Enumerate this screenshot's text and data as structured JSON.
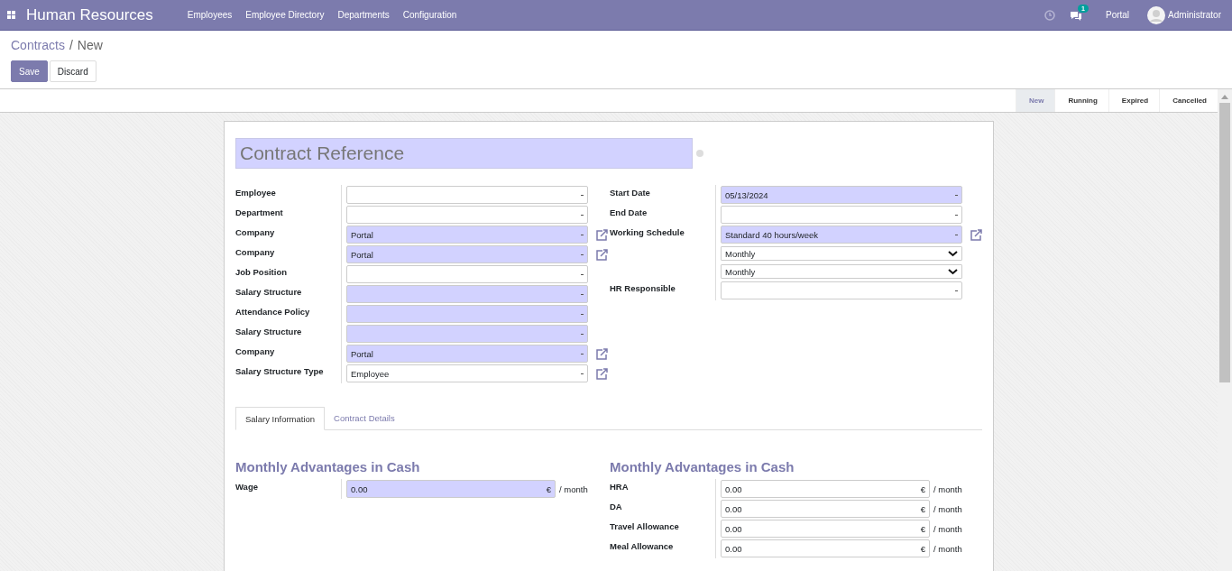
{
  "navbar": {
    "app_title": "Human Resources",
    "menu": [
      "Employees",
      "Employee Directory",
      "Departments",
      "Configuration"
    ],
    "messages_badge": "1",
    "company": "Portal",
    "user": "Administrator"
  },
  "breadcrumbs": [
    {
      "label": "Contracts",
      "link": true
    },
    {
      "separator": "/",
      "label": "New",
      "link": false
    }
  ],
  "buttons": [
    {
      "label": "Save",
      "kind": "primary"
    },
    {
      "label": "Discard",
      "kind": "secondary"
    }
  ],
  "statusbar": [
    {
      "label": "New",
      "selected": true
    },
    {
      "label": "Running",
      "selected": false
    },
    {
      "label": "Expired",
      "selected": false
    },
    {
      "label": "Cancelled",
      "selected": false
    }
  ],
  "form": {
    "title_placeholder": "Contract Reference",
    "left_fields": [
      {
        "label": "Employee",
        "kind": "many2one",
        "required": false,
        "link": false
      },
      {
        "label": "Department",
        "kind": "many2one",
        "required": false,
        "link": false
      },
      {
        "label": "Company",
        "kind": "many2one",
        "value": "Portal",
        "required": true,
        "link": true
      },
      {
        "label": "Company",
        "kind": "many2one",
        "value": "Portal",
        "required": true,
        "link": true
      },
      {
        "label": "Job Position",
        "kind": "many2one",
        "required": false,
        "link": false
      },
      {
        "label": "Salary Structure",
        "kind": "many2one",
        "required": true,
        "link": false
      },
      {
        "label": "Attendance Policy",
        "kind": "many2one",
        "required": true,
        "link": false
      },
      {
        "label": "Salary Structure",
        "kind": "many2one",
        "required": true,
        "link": false
      },
      {
        "label": "Company",
        "kind": "many2one",
        "value": "Portal",
        "required": true,
        "link": true
      },
      {
        "label": "Salary Structure Type",
        "kind": "many2one",
        "value": "Employee",
        "required": false,
        "link": true
      }
    ],
    "right_fields": [
      {
        "label": "Start Date",
        "kind": "date",
        "value": "05/13/2024",
        "required": true,
        "link": false
      },
      {
        "label": "End Date",
        "kind": "date",
        "required": false,
        "link": false
      },
      {
        "label": "Working Schedule",
        "kind": "many2one",
        "value": "Standard 40 hours/week",
        "required": true,
        "link": true
      },
      {
        "kind": "select",
        "value": "Monthly",
        "required": false,
        "link": false
      },
      {
        "kind": "select",
        "value": "Monthly",
        "required": false,
        "link": false
      },
      {
        "label": "HR Responsible",
        "kind": "many2one",
        "required": false,
        "link": false
      }
    ],
    "tabs": [
      {
        "label": "Salary Information",
        "selected": true
      },
      {
        "label": "Contract Details",
        "selected": false
      }
    ],
    "sections": [
      {
        "heading": "Monthly Advantages in Cash",
        "rows": [
          {
            "label": "Wage",
            "value": "0.00",
            "currency": "€",
            "unit": "/ month",
            "required": true
          }
        ]
      },
      {
        "heading": "Monthly Advantages in Cash",
        "rows": [
          {
            "label": "HRA",
            "value": "0.00",
            "currency": "€",
            "unit": "/ month",
            "required": false
          },
          {
            "label": "DA",
            "value": "0.00",
            "currency": "€",
            "unit": "/ month",
            "required": false
          },
          {
            "label": "Travel Allowance",
            "value": "0.00",
            "currency": "€",
            "unit": "/ month",
            "required": false
          },
          {
            "label": "Meal Allowance",
            "value": "0.00",
            "currency": "€",
            "unit": "/ month",
            "required": false
          }
        ]
      }
    ]
  }
}
